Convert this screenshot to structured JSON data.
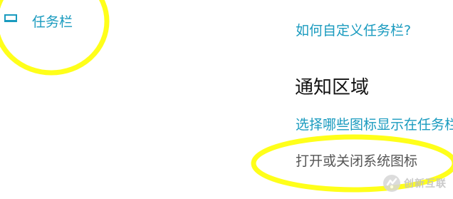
{
  "sidebar": {
    "taskbar_item": {
      "icon": "taskbar-icon",
      "label": "任务栏"
    }
  },
  "main": {
    "customize_link": "如何自定义任务栏?",
    "notification_area": {
      "heading": "通知区域",
      "choose_icons_link": "选择哪些图标显示在任务栏",
      "toggle_system_icons_link": "打开或关闭系统图标"
    }
  },
  "annotations": {
    "highlight_color": "#ffff1a"
  },
  "watermark": {
    "text": "创新互联",
    "icon": "brand-logo-icon"
  },
  "colors": {
    "accent": "#1a9bbf",
    "heading": "#111111",
    "plain_text": "#555555",
    "background": "#ffffff"
  }
}
